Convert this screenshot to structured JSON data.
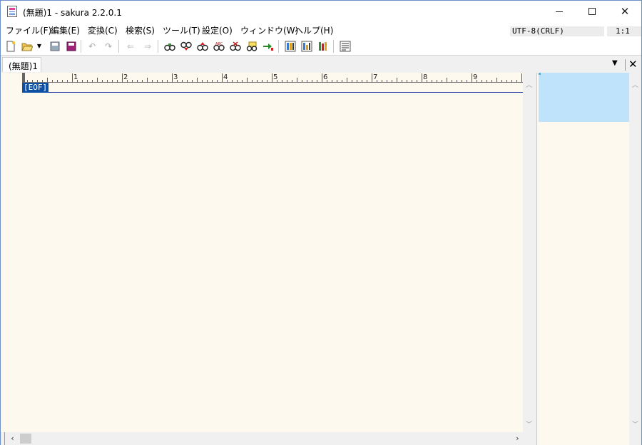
{
  "window": {
    "title": "(無題)1 - sakura 2.2.0.1"
  },
  "menu": [
    {
      "label": "ファイル(F)"
    },
    {
      "label": "編集(E)"
    },
    {
      "label": "変換(C)"
    },
    {
      "label": "検索(S)"
    },
    {
      "label": "ツール(T)"
    },
    {
      "label": "設定(O)"
    },
    {
      "label": "ウィンドウ(W)"
    },
    {
      "label": "ヘルプ(H)"
    }
  ],
  "status": {
    "encoding": "UTF-8(CRLF)",
    "position": "1:1"
  },
  "toolbar": {
    "icons": [
      "new-file-icon",
      "open-file-icon",
      "open-dropdown-icon",
      "save-icon",
      "save-all-icon",
      "undo-icon",
      "redo-icon",
      "move-back-icon",
      "move-forward-icon",
      "search-icon",
      "search-next-icon",
      "search-prev-icon",
      "replace-icon",
      "search-clear-icon",
      "grep-icon",
      "jump-icon",
      "outline-icon",
      "settings-icon",
      "type-settings-icon",
      "options-icon",
      "function-list-icon"
    ]
  },
  "tabs": [
    {
      "label": "(無題)1"
    }
  ],
  "ruler": {
    "numbers": [
      "1",
      "2",
      "3",
      "4",
      "5",
      "6",
      "7",
      "8",
      "9"
    ]
  },
  "editor": {
    "eof_marker": "[EOF]"
  },
  "colors": {
    "editor_bg": "#fdf9ef",
    "eof_bg": "#0d4fa3",
    "minimap_view": "#bfe3fb"
  }
}
